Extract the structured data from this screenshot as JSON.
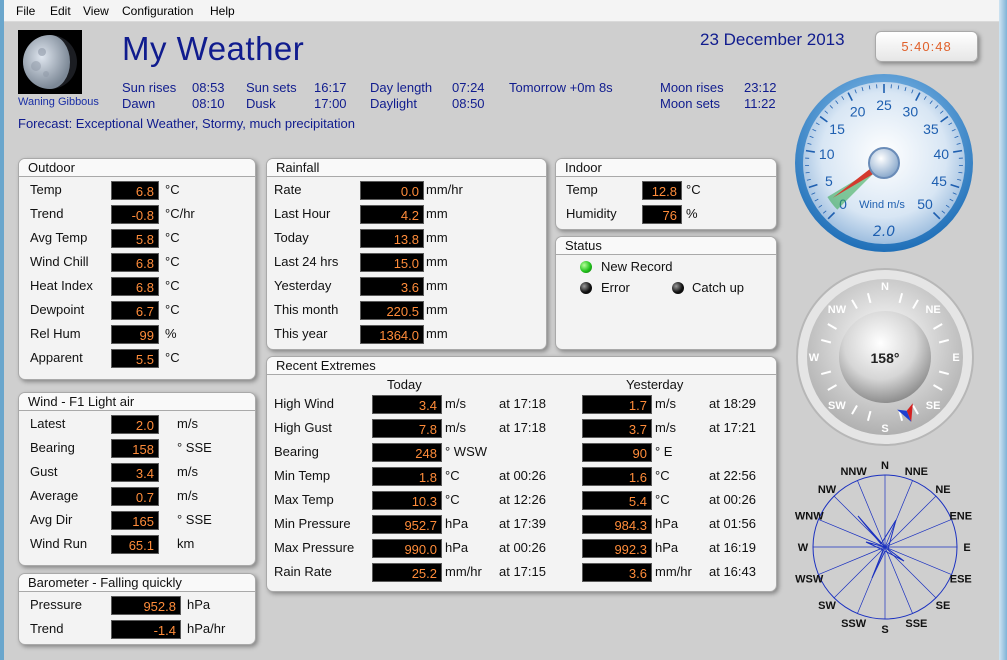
{
  "menu": [
    "File",
    "Edit",
    "View",
    "Configuration",
    "Help"
  ],
  "header": {
    "title": "My Weather",
    "date": "23 December 2013",
    "time": "5:40:48",
    "moon_phase": "Waning Gibbous",
    "forecast": "Forecast: Exceptional Weather, Stormy, much precipitation"
  },
  "almanac": {
    "sun_rises_label": "Sun rises",
    "sun_rises": "08:53",
    "sun_sets_label": "Sun sets",
    "sun_sets": "16:17",
    "day_length_label": "Day length",
    "day_length": "07:24",
    "tomorrow": "Tomorrow +0m 8s",
    "moon_rises_label": "Moon rises",
    "moon_rises": "23:12",
    "dawn_label": "Dawn",
    "dawn": "08:10",
    "dusk_label": "Dusk",
    "dusk": "17:00",
    "daylight_label": "Daylight",
    "daylight": "08:50",
    "moon_sets_label": "Moon sets",
    "moon_sets": "11:22"
  },
  "outdoor": {
    "title": "Outdoor",
    "rows": [
      {
        "label": "Temp",
        "value": "6.8",
        "unit": "°C"
      },
      {
        "label": "Trend",
        "value": "-0.8",
        "unit": "°C/hr"
      },
      {
        "label": "Avg Temp",
        "value": "5.8",
        "unit": "°C"
      },
      {
        "label": "Wind Chill",
        "value": "6.8",
        "unit": "°C"
      },
      {
        "label": "Heat Index",
        "value": "6.8",
        "unit": "°C"
      },
      {
        "label": "Dewpoint",
        "value": "6.7",
        "unit": "°C"
      },
      {
        "label": "Rel Hum",
        "value": "99",
        "unit": "%"
      },
      {
        "label": "Apparent",
        "value": "5.5",
        "unit": "°C"
      }
    ]
  },
  "rainfall": {
    "title": "Rainfall",
    "rows": [
      {
        "label": "Rate",
        "value": "0.0",
        "unit": "mm/hr"
      },
      {
        "label": "Last Hour",
        "value": "4.2",
        "unit": "mm"
      },
      {
        "label": "Today",
        "value": "13.8",
        "unit": "mm"
      },
      {
        "label": "Last 24 hrs",
        "value": "15.0",
        "unit": "mm"
      },
      {
        "label": "Yesterday",
        "value": "3.6",
        "unit": "mm"
      },
      {
        "label": "This month",
        "value": "220.5",
        "unit": "mm"
      },
      {
        "label": "This year",
        "value": "1364.0",
        "unit": "mm"
      }
    ]
  },
  "indoor": {
    "title": "Indoor",
    "rows": [
      {
        "label": "Temp",
        "value": "12.8",
        "unit": "°C"
      },
      {
        "label": "Humidity",
        "value": "76",
        "unit": "%"
      }
    ]
  },
  "status": {
    "title": "Status",
    "new_record": "New Record",
    "error": "Error",
    "catch_up": "Catch up"
  },
  "wind": {
    "title": "Wind - F1 Light air",
    "rows": [
      {
        "label": "Latest",
        "value": "2.0",
        "unit": "m/s"
      },
      {
        "label": "Bearing",
        "value": "158",
        "unit": "° SSE"
      },
      {
        "label": "Gust",
        "value": "3.4",
        "unit": "m/s"
      },
      {
        "label": "Average",
        "value": "0.7",
        "unit": "m/s"
      },
      {
        "label": "Avg Dir",
        "value": "165",
        "unit": "° SSE"
      },
      {
        "label": "Wind Run",
        "value": "65.1",
        "unit": "km"
      }
    ]
  },
  "barometer": {
    "title": "Barometer - Falling quickly",
    "rows": [
      {
        "label": "Pressure",
        "value": "952.8",
        "unit": "hPa"
      },
      {
        "label": "Trend",
        "value": "-1.4",
        "unit": "hPa/hr"
      }
    ]
  },
  "extremes": {
    "title": "Recent Extremes",
    "today_label": "Today",
    "yesterday_label": "Yesterday",
    "rows": [
      {
        "label": "High Wind",
        "today": "3.4",
        "today_unit": "m/s",
        "today_at": "at 17:18",
        "yday": "1.7",
        "yday_unit": "m/s",
        "yday_at": "at 18:29"
      },
      {
        "label": "High Gust",
        "today": "7.8",
        "today_unit": "m/s",
        "today_at": "at 17:18",
        "yday": "3.7",
        "yday_unit": "m/s",
        "yday_at": "at 17:21"
      },
      {
        "label": "Bearing",
        "today": "248",
        "today_unit": "°  WSW",
        "today_at": "",
        "yday": "90",
        "yday_unit": "°  E",
        "yday_at": ""
      },
      {
        "label": "Min Temp",
        "today": "1.8",
        "today_unit": "°C",
        "today_at": "at 00:26",
        "yday": "1.6",
        "yday_unit": "°C",
        "yday_at": "at 22:56"
      },
      {
        "label": "Max Temp",
        "today": "10.3",
        "today_unit": "°C",
        "today_at": "at 12:26",
        "yday": "5.4",
        "yday_unit": "°C",
        "yday_at": "at 00:26"
      },
      {
        "label": "Min Pressure",
        "today": "952.7",
        "today_unit": "hPa",
        "today_at": "at 17:39",
        "yday": "984.3",
        "yday_unit": "hPa",
        "yday_at": "at 01:56"
      },
      {
        "label": "Max Pressure",
        "today": "990.0",
        "today_unit": "hPa",
        "today_at": "at 00:26",
        "yday": "992.3",
        "yday_unit": "hPa",
        "yday_at": "at 16:19"
      },
      {
        "label": "Rain Rate",
        "today": "25.2",
        "today_unit": "mm/hr",
        "today_at": "at 17:15",
        "yday": "3.6",
        "yday_unit": "mm/hr",
        "yday_at": "at 16:43"
      }
    ]
  },
  "wind_gauge": {
    "ticks": [
      "0",
      "5",
      "10",
      "15",
      "20",
      "25",
      "30",
      "35",
      "40",
      "45",
      "50"
    ],
    "label": "Wind m/s",
    "readout": "2.0",
    "speed": 2.0,
    "max": 50
  },
  "compass": {
    "cardinals": [
      "N",
      "NE",
      "E",
      "SE",
      "S",
      "SW",
      "W",
      "NW"
    ],
    "bearing_text": "158°",
    "bearing": 158
  },
  "rose": {
    "labels": [
      "N",
      "NNE",
      "NE",
      "ENE",
      "E",
      "ESE",
      "SE",
      "SSE",
      "S",
      "SSW",
      "SW",
      "WSW",
      "W",
      "WNW",
      "NW",
      "NNW"
    ]
  },
  "colors": {
    "accent": "#101c8e",
    "value_text": "#ff8c3a",
    "value_bg": "#000000",
    "gauge_blue": "#1e5fb0"
  }
}
